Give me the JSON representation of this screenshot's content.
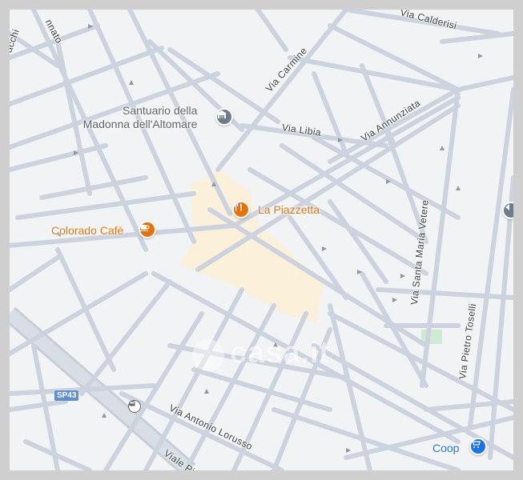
{
  "map": {
    "streets": [
      {
        "name": "Via Calderisi"
      },
      {
        "name": "Via Carmine"
      },
      {
        "name": "Via Libia"
      },
      {
        "name": "Via Annunziata"
      },
      {
        "name": "Via Santa Maria Vetere"
      },
      {
        "name": "Via Pietro Toselli"
      },
      {
        "name": "Via Antonio Lorusso"
      },
      {
        "name": "Viale Pio"
      },
      {
        "name": "Via Raffaele Gracchi partial",
        "text": "acchi"
      },
      {
        "name": "Via Annunziato partial",
        "text": "nnato"
      }
    ],
    "pois": [
      {
        "name": "Santuario della Madonna dell'Altomare",
        "line1": "Santuario della",
        "line2": "Madonna dell'Altomare",
        "icon": "church-icon",
        "color": "#6e7b8b"
      },
      {
        "name": "La Piazzetta",
        "icon": "restaurant-icon",
        "color": "#e8710a"
      },
      {
        "name": "Colorado Cafè",
        "icon": "cafe-icon",
        "color": "#e8710a"
      },
      {
        "name": "Coop",
        "icon": "shopping-cart-icon",
        "color": "#1a73e8"
      }
    ],
    "road_shield": "SP43",
    "watermark": "casa.it",
    "colors": {
      "background": "#f2f3f5",
      "road": "#ccd3de",
      "road_major": "#c3cbd8",
      "highlight_area": "#fbf0d9",
      "park": "#cdebd3",
      "poi_orange": "#e8710a",
      "poi_blue": "#1a73e8",
      "poi_gray": "#6e7b8b"
    }
  }
}
